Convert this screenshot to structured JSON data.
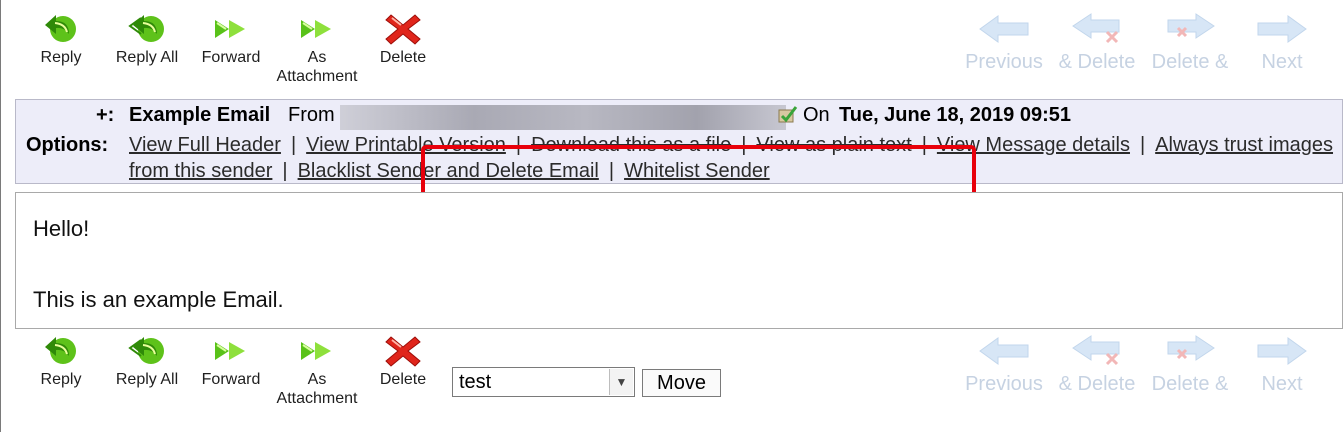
{
  "toolbar": {
    "reply": "Reply",
    "reply_all": "Reply All",
    "forward": "Forward",
    "as_attachment_1": "As",
    "as_attachment_2": "Attachment",
    "delete": "Delete",
    "previous": "Previous",
    "and_delete": "& Delete",
    "delete_and": "Delete &",
    "next": "Next"
  },
  "header": {
    "expand": "+:",
    "subject": "Example Email",
    "from_label": "From",
    "on_label": "On",
    "date": "Tue, June 18, 2019 09:51",
    "options_label": "Options:",
    "options": {
      "view_full_header": "View Full Header",
      "view_printable": "View Printable Version",
      "download_file": "Download this as a file",
      "view_plain_text": "View as plain text",
      "view_message_details": "View Message details",
      "always_trust": "Always trust images from this sender",
      "blacklist": "Blacklist Sender and Delete Email",
      "whitelist": "Whitelist Sender",
      "separator": "|"
    }
  },
  "message": {
    "line1": "Hello!",
    "line2": "This is an example Email."
  },
  "move": {
    "folder_selected": "test",
    "move_label": "Move"
  },
  "colors": {
    "header_bg": "#ededf9",
    "highlight": "#e8000b",
    "nav_disabled": "#c6d2e2"
  }
}
